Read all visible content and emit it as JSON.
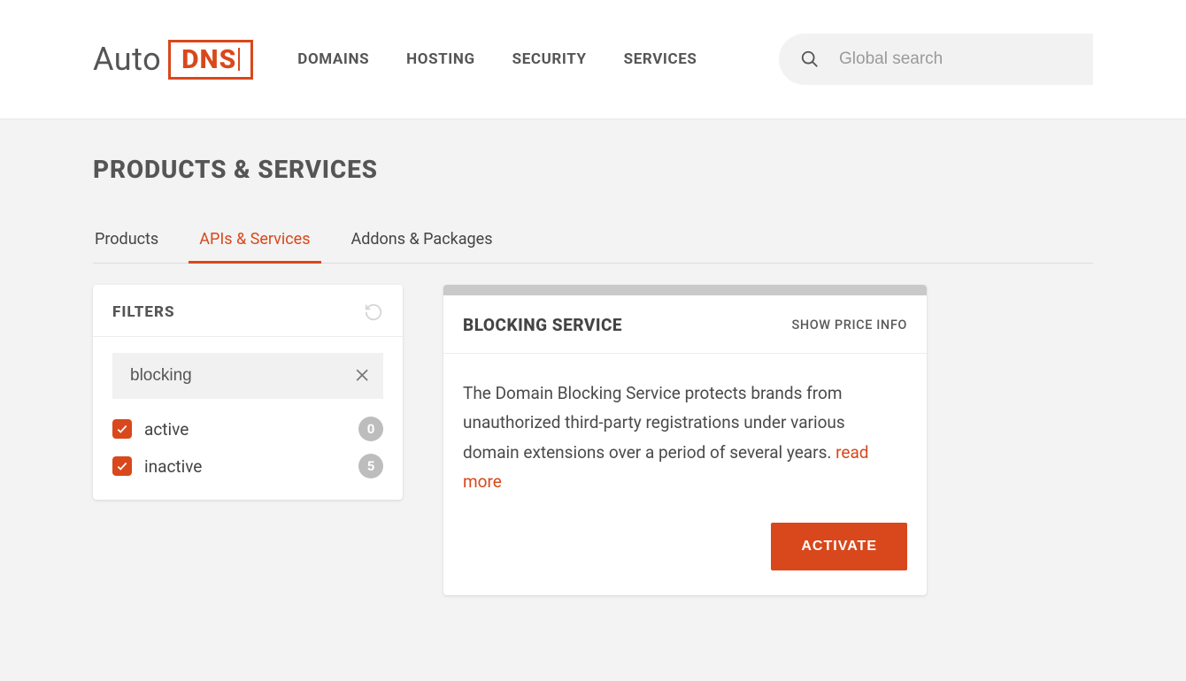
{
  "logo": {
    "part1": "Auto",
    "part2": "DNS"
  },
  "nav": {
    "items": [
      "DOMAINS",
      "HOSTING",
      "SECURITY",
      "SERVICES"
    ]
  },
  "search": {
    "placeholder": "Global search"
  },
  "page": {
    "title": "PRODUCTS & SERVICES"
  },
  "tabs": {
    "items": [
      {
        "label": "Products",
        "active": false
      },
      {
        "label": "APIs & Services",
        "active": true
      },
      {
        "label": "Addons & Packages",
        "active": false
      }
    ]
  },
  "filters": {
    "title": "FILTERS",
    "search_value": "blocking",
    "options": [
      {
        "label": "active",
        "count": "0",
        "checked": true
      },
      {
        "label": "inactive",
        "count": "5",
        "checked": true
      }
    ]
  },
  "service": {
    "title": "BLOCKING SERVICE",
    "price_link": "SHOW PRICE INFO",
    "description": "The Domain Blocking Service protects brands from unauthorized third-party registrations under various domain extensions over a period of several years. ",
    "read_more": "read more",
    "activate": "ACTIVATE"
  }
}
